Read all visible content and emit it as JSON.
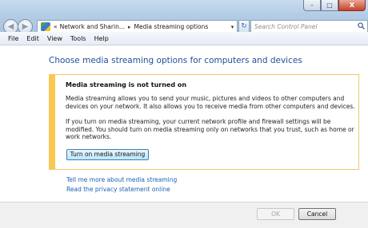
{
  "window": {
    "controls": {
      "minimize": "–",
      "maximize": "□",
      "close": "X"
    }
  },
  "nav": {
    "back_glyph": "◀",
    "forward_glyph": "▶"
  },
  "address": {
    "overflow_glyph": "«",
    "crumb_1": "Network and Sharin...",
    "separator": "▸",
    "crumb_2": "Media streaming options",
    "dropdown_glyph": "▾",
    "refresh_glyph": "↻"
  },
  "search": {
    "placeholder": "Search Control Panel"
  },
  "menu": {
    "items": [
      "File",
      "Edit",
      "View",
      "Tools",
      "Help"
    ]
  },
  "main": {
    "title": "Choose media streaming options for computers and devices",
    "notice": {
      "heading": "Media streaming is not turned on",
      "paragraph_1": "Media streaming allows you to send your music, pictures and videos to other computers and devices on your network. It also allows you to receive media from other computers and devices.",
      "paragraph_2": "If you turn on media streaming, your current network profile and firewall settings will be modified. You should turn on media streaming only on networks that you trust, such as home or work networks.",
      "button_label": "Turn on media streaming"
    },
    "links": {
      "more": "Tell me more about media streaming",
      "privacy": "Read the privacy statement online"
    }
  },
  "footer": {
    "ok_label": "OK",
    "cancel_label": "Cancel"
  },
  "colors": {
    "accent_title": "#1e4f9a",
    "link": "#1e5fb5",
    "notice_bar": "#f7c84a",
    "notice_border": "#f2c66d"
  },
  "icons": {
    "back": "back-arrow-icon",
    "forward": "forward-arrow-icon",
    "control_panel": "control-panel-icon",
    "refresh": "refresh-icon",
    "search": "search-icon"
  }
}
